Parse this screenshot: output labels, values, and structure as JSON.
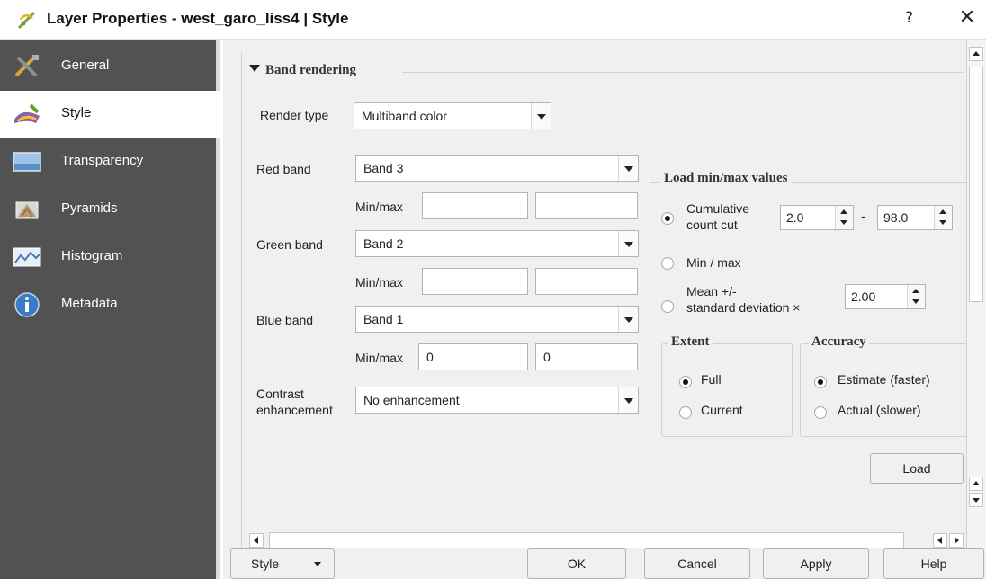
{
  "window": {
    "title": "Layer Properties - west_garo_liss4 | Style",
    "help_label": "?",
    "close_label": "✕"
  },
  "sidebar": {
    "items": [
      {
        "label": "General",
        "icon": "wrench-screwdriver-icon"
      },
      {
        "label": "Style",
        "icon": "paintbrush-icon"
      },
      {
        "label": "Transparency",
        "icon": "transparency-icon"
      },
      {
        "label": "Pyramids",
        "icon": "pyramids-icon"
      },
      {
        "label": "Histogram",
        "icon": "histogram-icon"
      },
      {
        "label": "Metadata",
        "icon": "info-icon"
      }
    ],
    "selected": "Style"
  },
  "band_rendering": {
    "title": "Band rendering",
    "render_type_label": "Render type",
    "render_type_value": "Multiband color",
    "red_band_label": "Red band",
    "red_band_value": "Band 3",
    "red_minmax_label": "Min/max",
    "red_min": "",
    "red_max": "",
    "green_band_label": "Green band",
    "green_band_value": "Band 2",
    "green_minmax_label": "Min/max",
    "green_min": "",
    "green_max": "",
    "blue_band_label": "Blue band",
    "blue_band_value": "Band 1",
    "blue_minmax_label": "Min/max",
    "blue_min": "0",
    "blue_max": "0",
    "contrast_label_line1": "Contrast",
    "contrast_label_line2": "enhancement",
    "contrast_value": "No enhancement"
  },
  "load_minmax": {
    "title": "Load min/max values",
    "cumulative_label_line1": "Cumulative",
    "cumulative_label_line2": "count cut",
    "cumulative_from": "2.0",
    "range_separator": "-",
    "cumulative_to": "98.0",
    "minmax_label": "Min / max",
    "mean_label_line1": "Mean +/-",
    "mean_label_line2": "standard deviation ×",
    "mean_value": "2.00",
    "selected": "Cumulative count cut",
    "extent": {
      "title": "Extent",
      "full": "Full",
      "current": "Current",
      "selected": "Full"
    },
    "accuracy": {
      "title": "Accuracy",
      "estimate": "Estimate (faster)",
      "actual": "Actual (slower)",
      "selected": "Estimate (faster)"
    },
    "load_button": "Load"
  },
  "footer": {
    "style_button": "Style",
    "ok": "OK",
    "cancel": "Cancel",
    "apply": "Apply",
    "help": "Help"
  },
  "colors": {
    "sidebar_bg": "#525252",
    "panel_bg": "#f0f0f0"
  }
}
